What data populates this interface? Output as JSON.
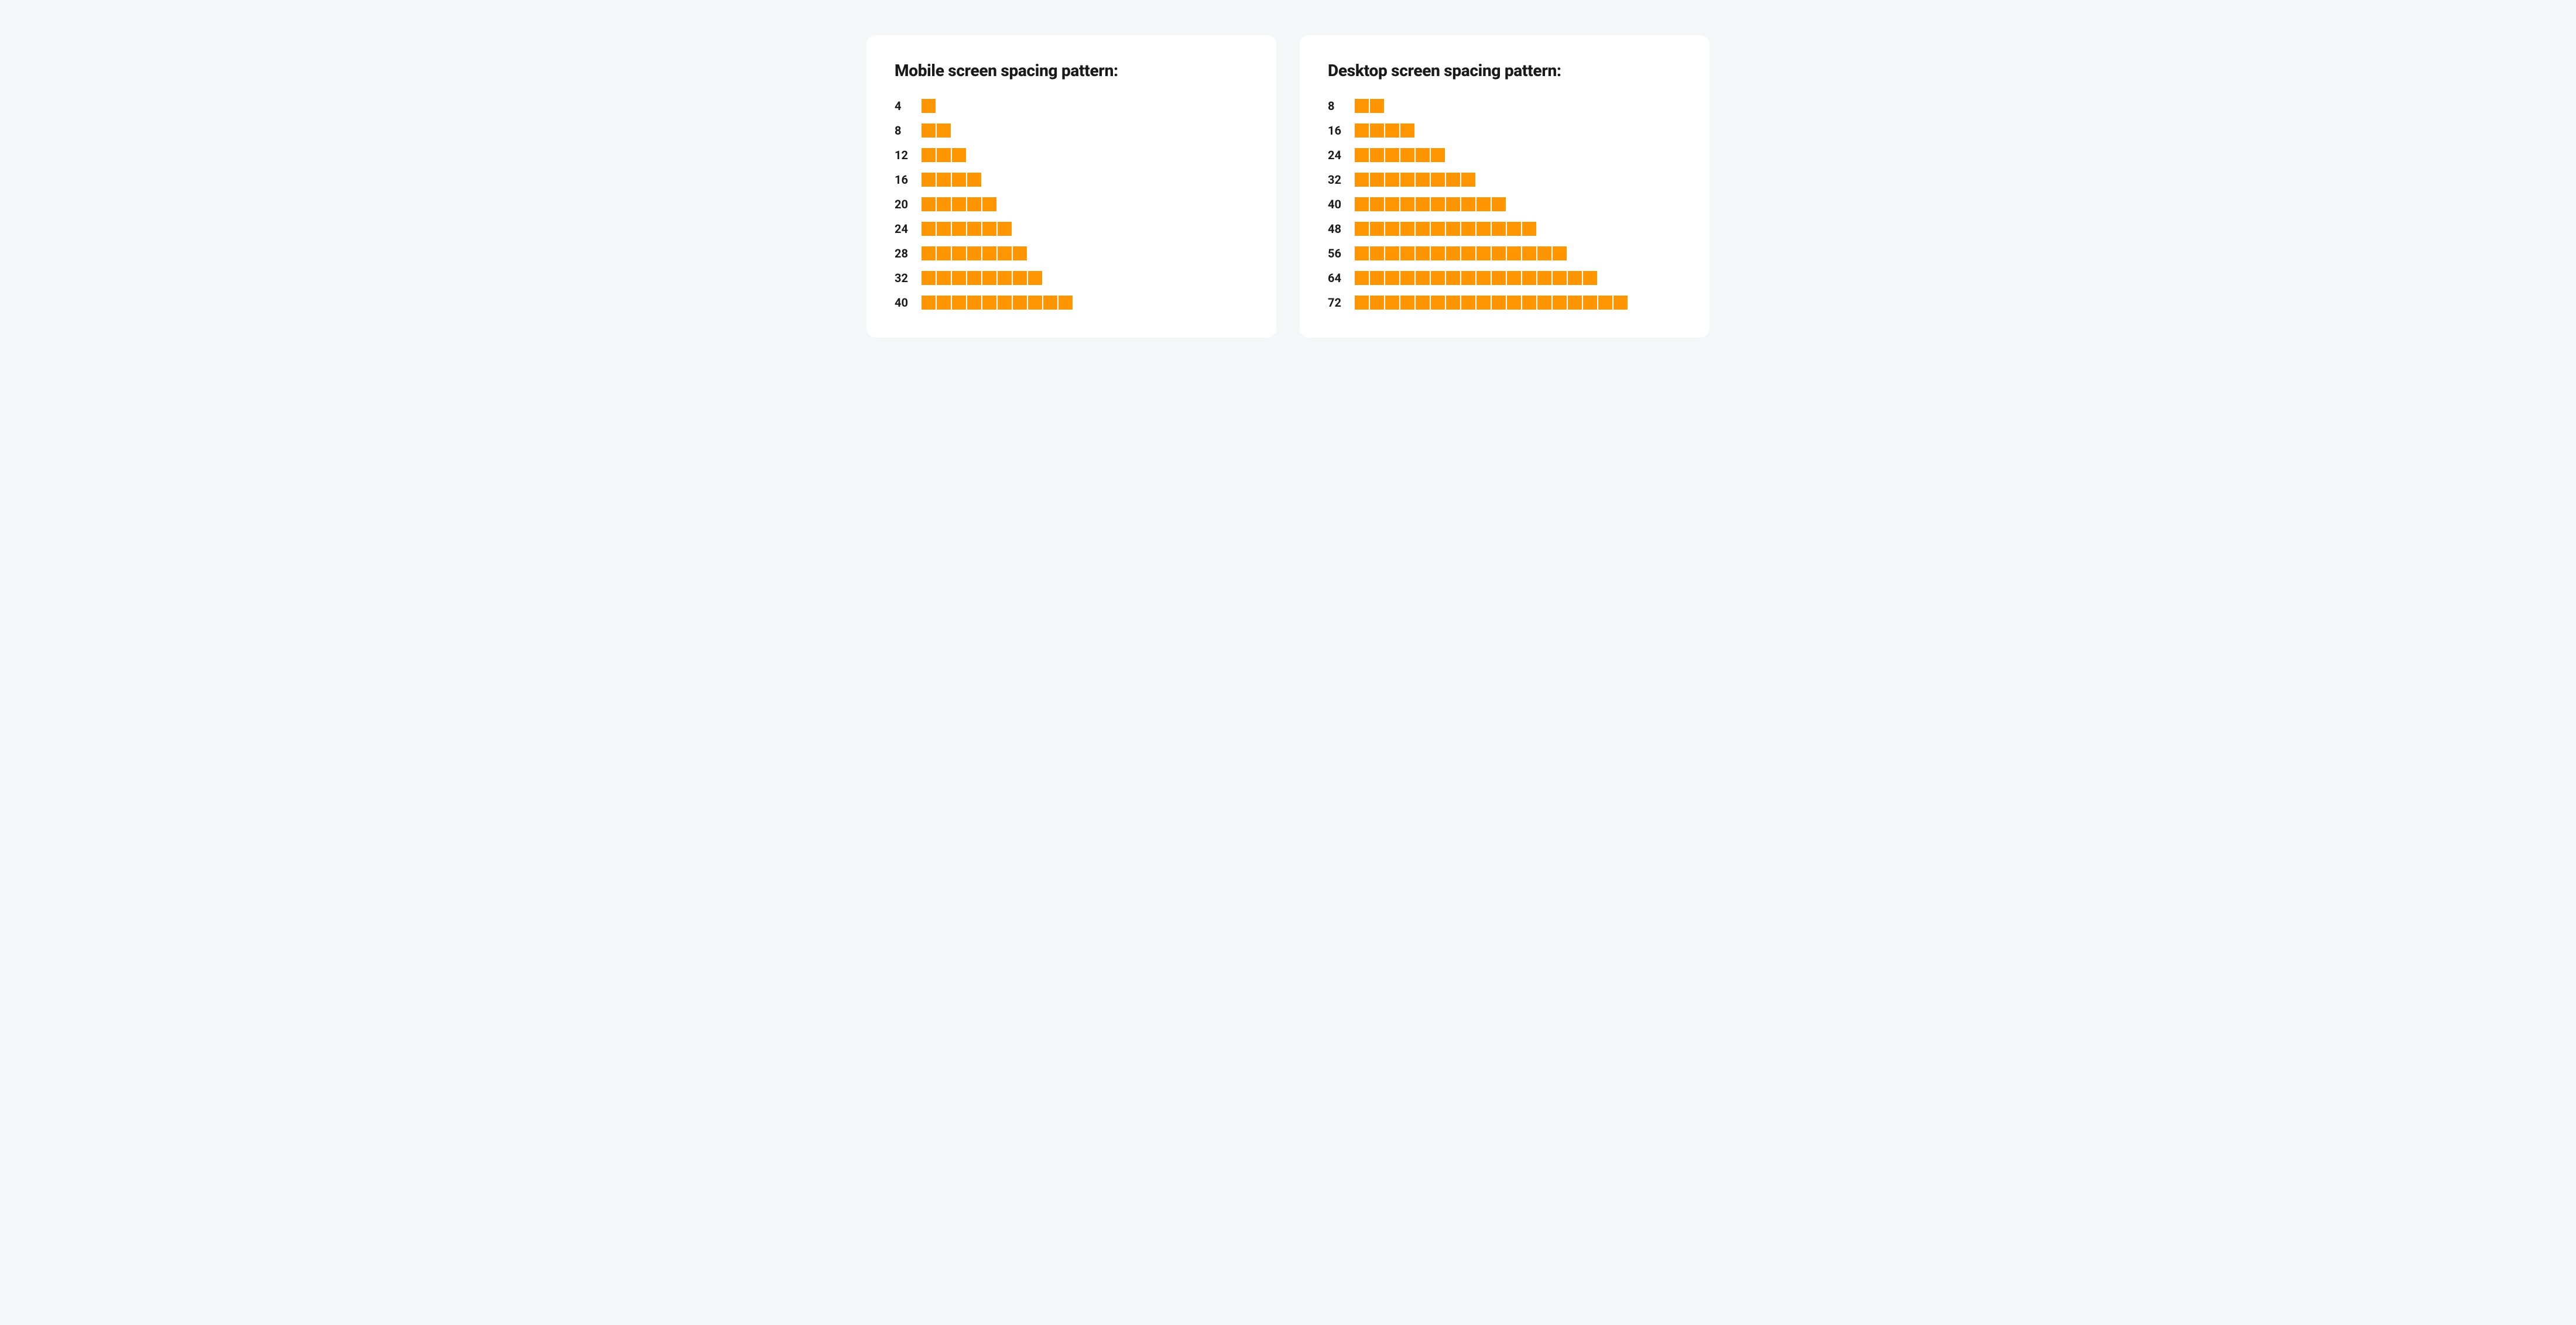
{
  "panels": [
    {
      "title": "Mobile screen spacing pattern:",
      "rows": [
        {
          "label": "4",
          "cells": 1
        },
        {
          "label": "8",
          "cells": 2
        },
        {
          "label": "12",
          "cells": 3
        },
        {
          "label": "16",
          "cells": 4
        },
        {
          "label": "20",
          "cells": 5
        },
        {
          "label": "24",
          "cells": 6
        },
        {
          "label": "28",
          "cells": 7
        },
        {
          "label": "32",
          "cells": 8
        },
        {
          "label": "40",
          "cells": 10
        }
      ]
    },
    {
      "title": "Desktop screen spacing pattern:",
      "rows": [
        {
          "label": "8",
          "cells": 2
        },
        {
          "label": "16",
          "cells": 4
        },
        {
          "label": "24",
          "cells": 6
        },
        {
          "label": "32",
          "cells": 8
        },
        {
          "label": "40",
          "cells": 10
        },
        {
          "label": "48",
          "cells": 12
        },
        {
          "label": "56",
          "cells": 14
        },
        {
          "label": "64",
          "cells": 16
        },
        {
          "label": "72",
          "cells": 18
        }
      ]
    }
  ],
  "colors": {
    "cell": "#ff9500",
    "background": "#f5f6f7",
    "card": "#ffffff",
    "text": "#1a1a1a"
  },
  "chart_data": [
    {
      "type": "bar",
      "title": "Mobile screen spacing pattern:",
      "categories": [
        "4",
        "8",
        "12",
        "16",
        "20",
        "24",
        "28",
        "32",
        "40"
      ],
      "values": [
        4,
        8,
        12,
        16,
        20,
        24,
        28,
        32,
        40
      ],
      "unit_step": 4,
      "xlabel": "",
      "ylabel": "",
      "orientation": "horizontal"
    },
    {
      "type": "bar",
      "title": "Desktop screen spacing pattern:",
      "categories": [
        "8",
        "16",
        "24",
        "32",
        "40",
        "48",
        "56",
        "64",
        "72"
      ],
      "values": [
        8,
        16,
        24,
        32,
        40,
        48,
        56,
        64,
        72
      ],
      "unit_step": 4,
      "xlabel": "",
      "ylabel": "",
      "orientation": "horizontal"
    }
  ]
}
